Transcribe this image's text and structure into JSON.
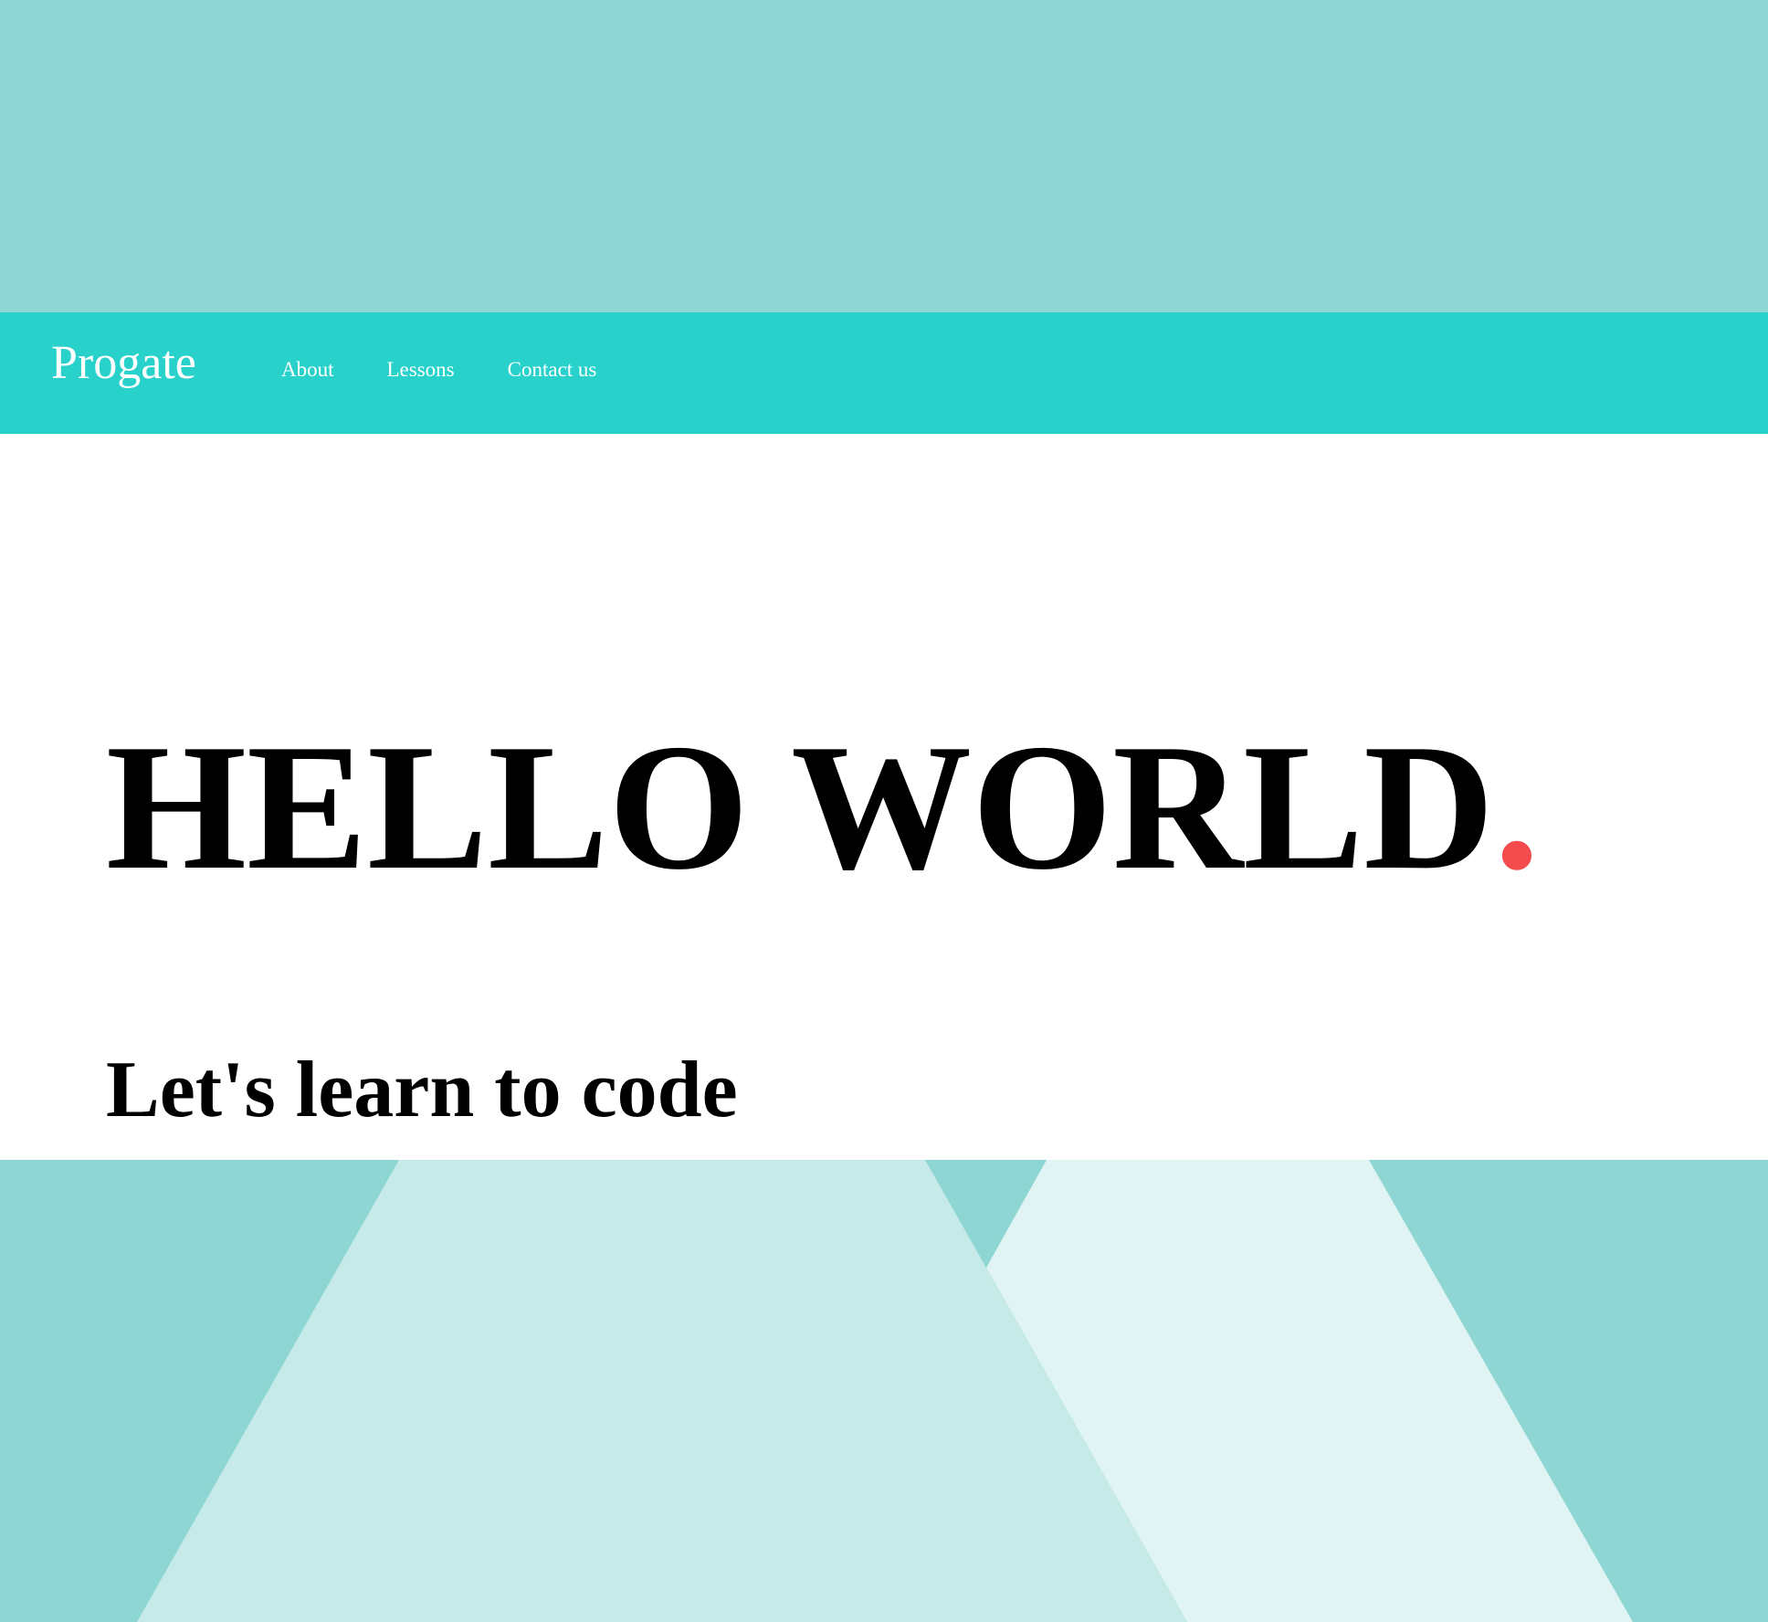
{
  "header": {
    "logo": "Progate",
    "nav": [
      {
        "label": "About"
      },
      {
        "label": "Lessons"
      },
      {
        "label": "Contact us"
      }
    ]
  },
  "hero": {
    "title": "HELLO WORLD",
    "title_dot": ".",
    "subtitle": "Let's learn to code"
  },
  "colors": {
    "background": "#8ed6d3",
    "navbar": "#29d1cb",
    "accent_dot": "#f44b4f",
    "shape_light": "#c5eae7",
    "shape_lighter": "#e0f4f3"
  }
}
